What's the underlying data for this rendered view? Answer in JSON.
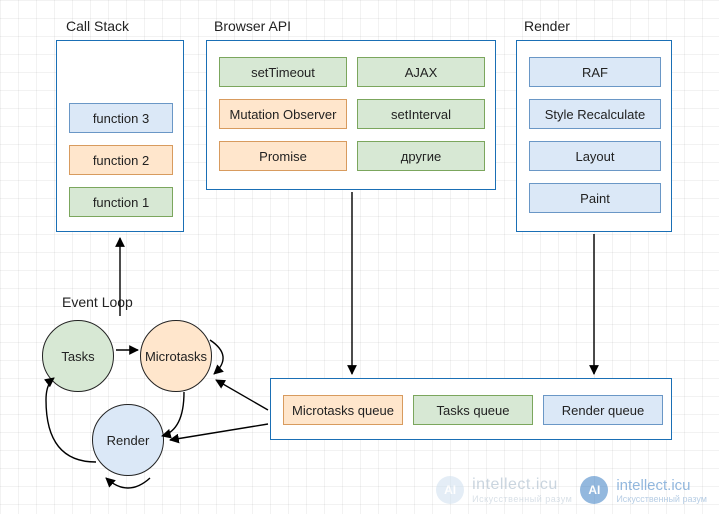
{
  "sections": {
    "callStack": "Call Stack",
    "browserApi": "Browser API",
    "render": "Render",
    "eventLoop": "Event Loop"
  },
  "callStack": {
    "items": [
      "function 3",
      "function 2",
      "function 1"
    ]
  },
  "browserApi": {
    "col1": [
      "setTimeout",
      "Mutation Observer",
      "Promise"
    ],
    "col2": [
      "AJAX",
      "setInterval",
      "другие"
    ]
  },
  "render": {
    "items": [
      "RAF",
      "Style Recalculate",
      "Layout",
      "Paint"
    ]
  },
  "eventLoop": {
    "tasks": "Tasks",
    "microtasks": "Microtasks",
    "render": "Render"
  },
  "queues": {
    "micro": "Microtasks queue",
    "tasks": "Tasks queue",
    "render": "Render queue"
  },
  "watermark": {
    "brand": "intellect.icu",
    "tagline": "Искусственный разум",
    "badge": "AI"
  }
}
